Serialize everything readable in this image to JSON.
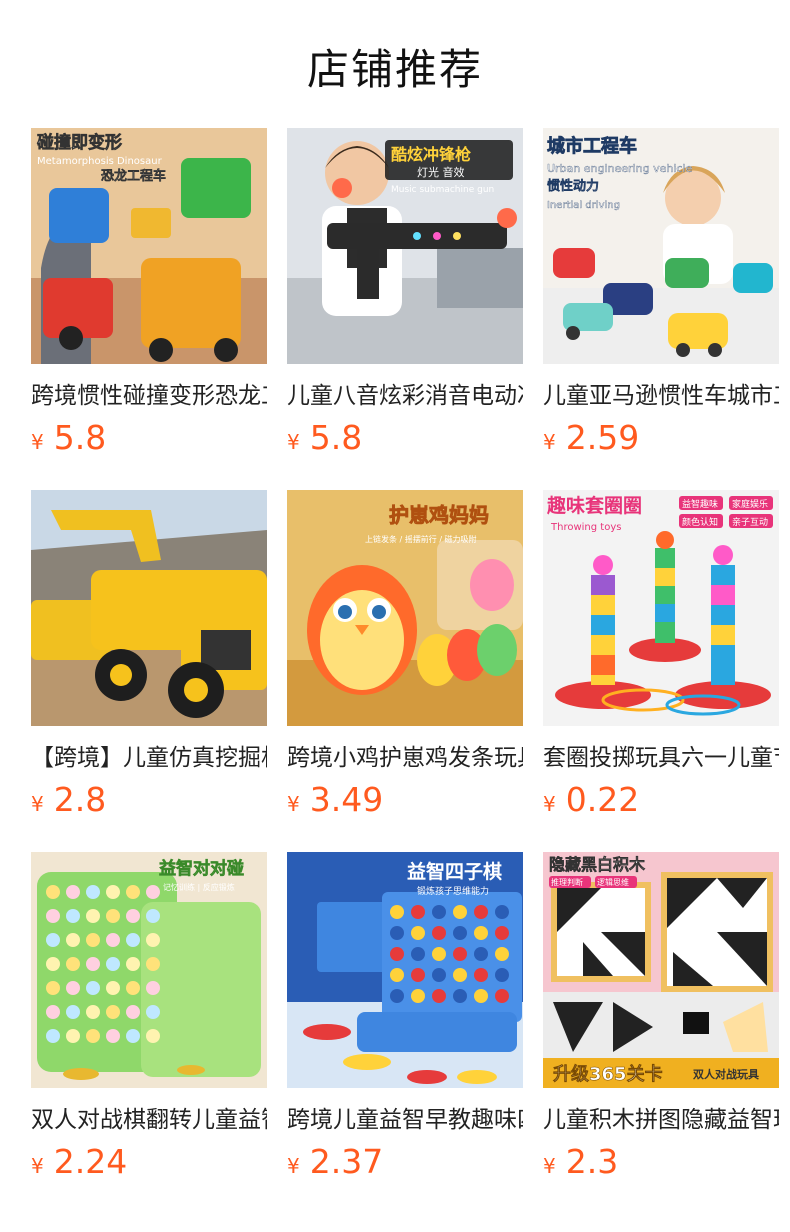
{
  "page": {
    "title": "店铺推荐"
  },
  "currency_symbol": "¥",
  "products": [
    {
      "name": "跨境惯性碰撞变形恐龙工程车",
      "price": "5.8",
      "image_text": [
        "碰撞即变形",
        "Metamorphosis Dinosaur",
        "恐龙工程车"
      ]
    },
    {
      "name": "儿童八音炫彩消音电动冲锋枪",
      "price": "5.8",
      "image_text": [
        "酷炫冲锋枪",
        "灯光 音效",
        "Music submachine gun"
      ]
    },
    {
      "name": "儿童亚马逊惯性车城市工程车",
      "price": "2.59",
      "image_text": [
        "城市工程车",
        "Urban engineering vehicle",
        "惯性动力",
        "Inertial driving"
      ]
    },
    {
      "name": "【跨境】儿童仿真挖掘机工程车",
      "price": "2.8",
      "image_text": []
    },
    {
      "name": "跨境小鸡护崽鸡发条玩具",
      "price": "3.49",
      "image_text": [
        "护崽鸡妈妈",
        "上链发条 / 摇摆前行 / 磁力吸附"
      ]
    },
    {
      "name": "套圈投掷玩具六一儿童节",
      "price": "0.22",
      "image_text": [
        "趣味套圈圈",
        "Throwing toys",
        "益智趣味",
        "家庭娱乐",
        "颜色认知",
        "亲子互动"
      ]
    },
    {
      "name": "双人对战棋翻转儿童益智",
      "price": "2.24",
      "image_text": [
        "益智对对碰",
        "记忆训练 | 反应锻炼"
      ]
    },
    {
      "name": "跨境儿童益智早教趣味四子棋",
      "price": "2.37",
      "image_text": [
        "益智四子棋",
        "锻炼孩子思维能力"
      ]
    },
    {
      "name": "儿童积木拼图隐藏益智玩具",
      "price": "2.3",
      "image_text": [
        "隐藏黑白积木",
        "推理判断",
        "逻辑思维",
        "升级365关卡",
        "双人对战玩具"
      ]
    }
  ],
  "colors": {
    "price": "#ff5a1f",
    "title": "#111111",
    "name": "#222222"
  }
}
